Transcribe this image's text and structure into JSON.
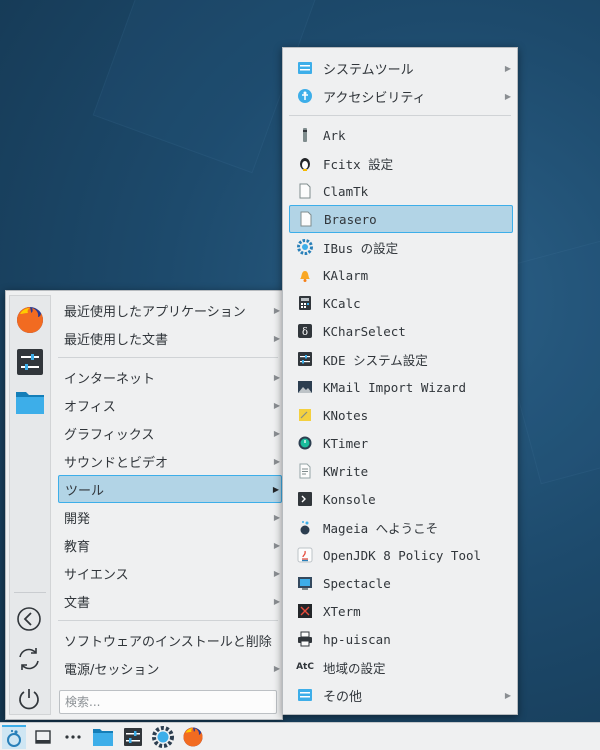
{
  "categories": [
    {
      "label": "最近使用したアプリケーション",
      "arrow": "▶"
    },
    {
      "label": "最近使用した文書",
      "arrow": "▶"
    },
    {
      "label": "インターネット",
      "arrow": "▶"
    },
    {
      "label": "オフィス",
      "arrow": "▶"
    },
    {
      "label": "グラフィックス",
      "arrow": "▶"
    },
    {
      "label": "サウンドとビデオ",
      "arrow": "▶"
    },
    {
      "label": "ツール",
      "arrow": "▶"
    },
    {
      "label": "開発",
      "arrow": "▶"
    },
    {
      "label": "教育",
      "arrow": "▶"
    },
    {
      "label": "サイエンス",
      "arrow": "▶"
    },
    {
      "label": "文書",
      "arrow": "▶"
    },
    {
      "label": "ソフトウェアのインストールと削除"
    },
    {
      "label": "電源/セッション",
      "arrow": "▶"
    }
  ],
  "search": {
    "placeholder": "検索..."
  },
  "submenu": [
    {
      "label": "システムツール",
      "icon": "system-tools-icon",
      "arrow": "▶"
    },
    {
      "label": "アクセシビリティ",
      "icon": "accessibility-icon",
      "arrow": "▶"
    },
    {
      "label": "Ark",
      "icon": "ark-icon"
    },
    {
      "label": "Fcitx 設定",
      "icon": "fcitx-penguin-icon"
    },
    {
      "label": "ClamTk",
      "icon": "document-icon"
    },
    {
      "label": "Brasero",
      "icon": "document-icon"
    },
    {
      "label": "IBus の設定",
      "icon": "ibus-gear-icon"
    },
    {
      "label": "KAlarm",
      "icon": "bell-icon"
    },
    {
      "label": "KCalc",
      "icon": "calculator-icon"
    },
    {
      "label": "KCharSelect",
      "icon": "charselect-icon"
    },
    {
      "label": "KDE システム設定",
      "icon": "system-settings-icon"
    },
    {
      "label": "KMail Import Wizard",
      "icon": "kmail-import-icon"
    },
    {
      "label": "KNotes",
      "icon": "notes-icon"
    },
    {
      "label": "KTimer",
      "icon": "timer-icon"
    },
    {
      "label": "KWrite",
      "icon": "kwrite-icon"
    },
    {
      "label": "Konsole",
      "icon": "terminal-icon"
    },
    {
      "label": "Mageia へようこそ",
      "icon": "mageia-icon"
    },
    {
      "label": "OpenJDK 8 Policy Tool",
      "icon": "java-icon"
    },
    {
      "label": "Spectacle",
      "icon": "spectacle-icon"
    },
    {
      "label": "XTerm",
      "icon": "xterm-icon"
    },
    {
      "label": "hp-uiscan",
      "icon": "printer-icon"
    },
    {
      "label": "地域の設定",
      "icon": "locale-icon",
      "icon_text": "AtC"
    },
    {
      "label": "その他",
      "icon": "other-folder-icon",
      "arrow": "▶"
    }
  ],
  "colors": {
    "accent": "#3daee9",
    "highlight": "#b2d4e6",
    "panel": "#eff0f1"
  }
}
